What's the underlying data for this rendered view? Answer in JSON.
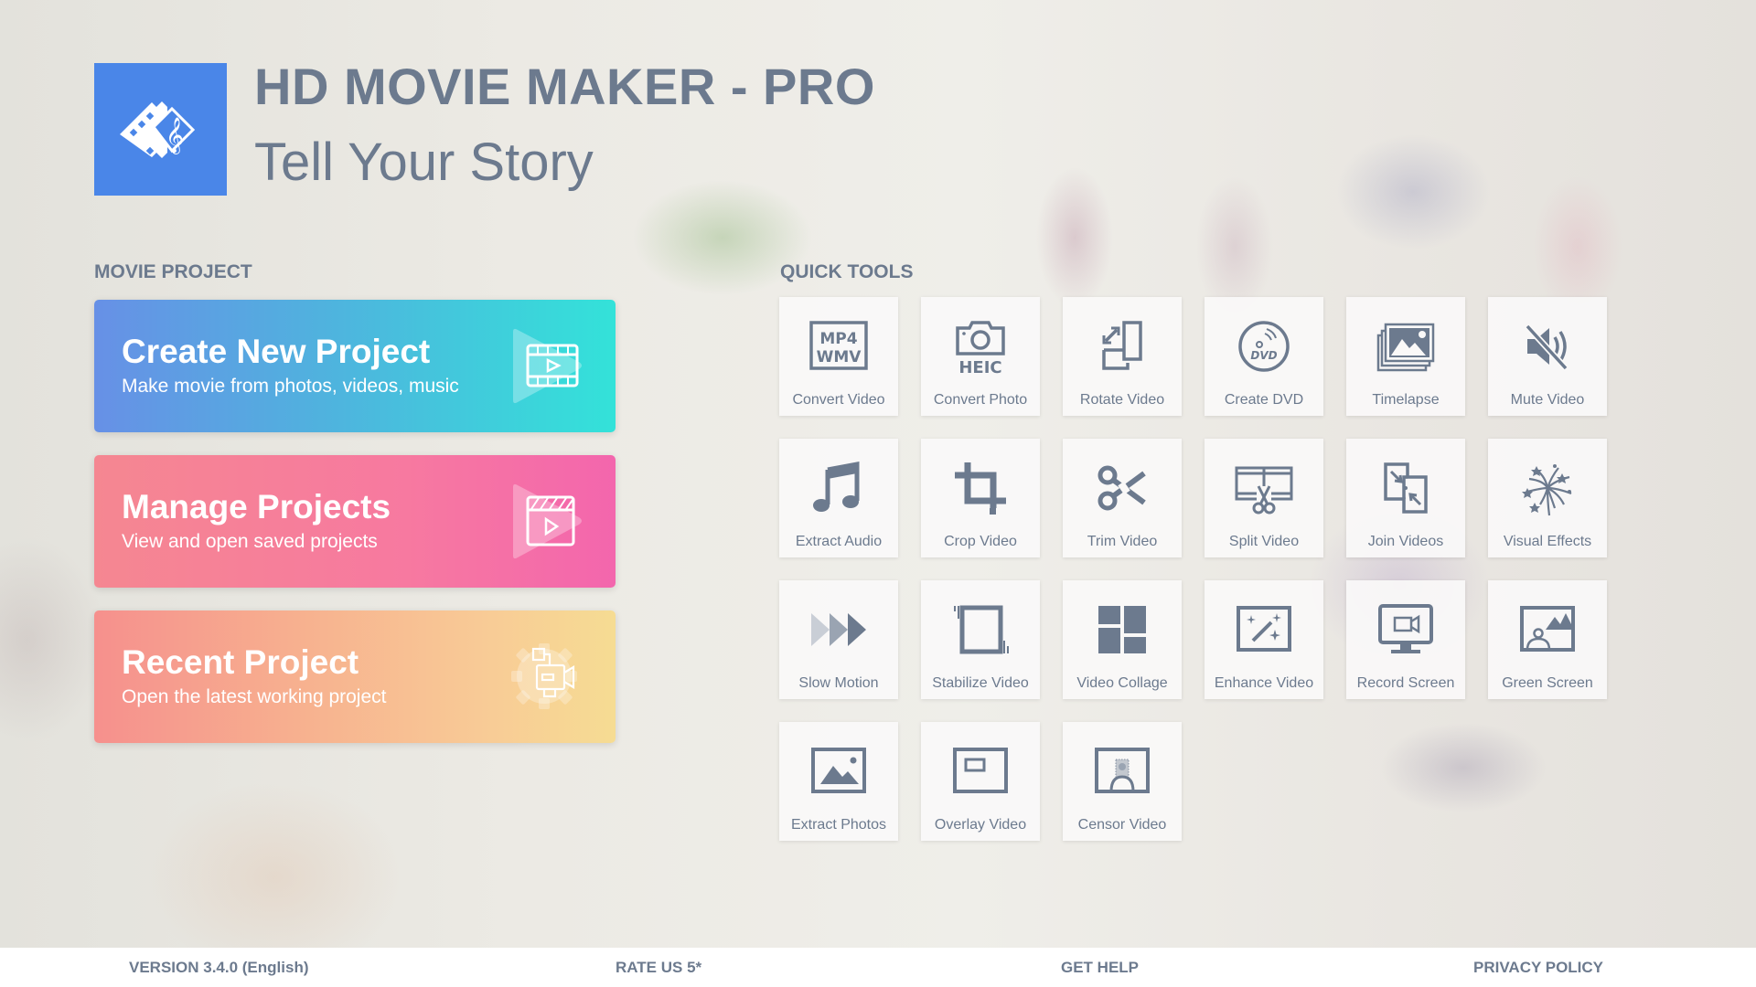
{
  "header": {
    "app_title": "HD MOVIE MAKER - PRO",
    "tagline": "Tell Your Story",
    "logo_color": "#4a86e8"
  },
  "movie_project": {
    "section_label": "MOVIE PROJECT",
    "cards": [
      {
        "id": "create",
        "title": "Create New Project",
        "subtitle": "Make movie from photos, videos, music",
        "icon": "film-play-icon"
      },
      {
        "id": "manage",
        "title": "Manage Projects",
        "subtitle": "View and open saved projects",
        "icon": "clapperboard-play-icon"
      },
      {
        "id": "recent",
        "title": "Recent Project",
        "subtitle": "Open the latest working project",
        "icon": "video-camera-gear-icon"
      }
    ]
  },
  "quick_tools": {
    "section_label": "QUICK TOOLS",
    "items": [
      {
        "label": "Convert Video",
        "icon": "mp4-wmv-icon",
        "badge_top": "MP4",
        "badge_bottom": "WMV"
      },
      {
        "label": "Convert Photo",
        "icon": "camera-heic-icon",
        "badge": "HEIC"
      },
      {
        "label": "Rotate Video",
        "icon": "rotate-icon"
      },
      {
        "label": "Create DVD",
        "icon": "dvd-icon",
        "badge": "DVD"
      },
      {
        "label": "Timelapse",
        "icon": "photo-stack-icon"
      },
      {
        "label": "Mute Video",
        "icon": "mute-icon"
      },
      {
        "label": "Extract Audio",
        "icon": "music-note-icon"
      },
      {
        "label": "Crop Video",
        "icon": "crop-icon"
      },
      {
        "label": "Trim Video",
        "icon": "scissors-icon"
      },
      {
        "label": "Split Video",
        "icon": "film-scissors-icon"
      },
      {
        "label": "Join Videos",
        "icon": "join-icon"
      },
      {
        "label": "Visual Effects",
        "icon": "fireworks-icon"
      },
      {
        "label": "Slow Motion",
        "icon": "triple-play-icon"
      },
      {
        "label": "Stabilize Video",
        "icon": "stabilize-icon"
      },
      {
        "label": "Video Collage",
        "icon": "collage-icon"
      },
      {
        "label": "Enhance Video",
        "icon": "magic-wand-icon"
      },
      {
        "label": "Record Screen",
        "icon": "monitor-camera-icon"
      },
      {
        "label": "Green Screen",
        "icon": "person-landscape-icon"
      },
      {
        "label": "Extract Photos",
        "icon": "image-icon"
      },
      {
        "label": "Overlay Video",
        "icon": "overlay-icon"
      },
      {
        "label": "Censor Video",
        "icon": "censor-icon"
      }
    ]
  },
  "footer": {
    "version": "VERSION 3.4.0 (English)",
    "rate_us": "RATE US 5*",
    "get_help": "GET HELP",
    "privacy_policy": "PRIVACY POLICY"
  },
  "colors": {
    "text": "#6c7a8e",
    "tile_bg": "#faf9f8",
    "create_gradient": [
      "#6790e6",
      "#33e2d9"
    ],
    "manage_gradient": [
      "#f58791",
      "#f366ad"
    ],
    "recent_gradient": [
      "#f6908d",
      "#f6dc93"
    ]
  }
}
